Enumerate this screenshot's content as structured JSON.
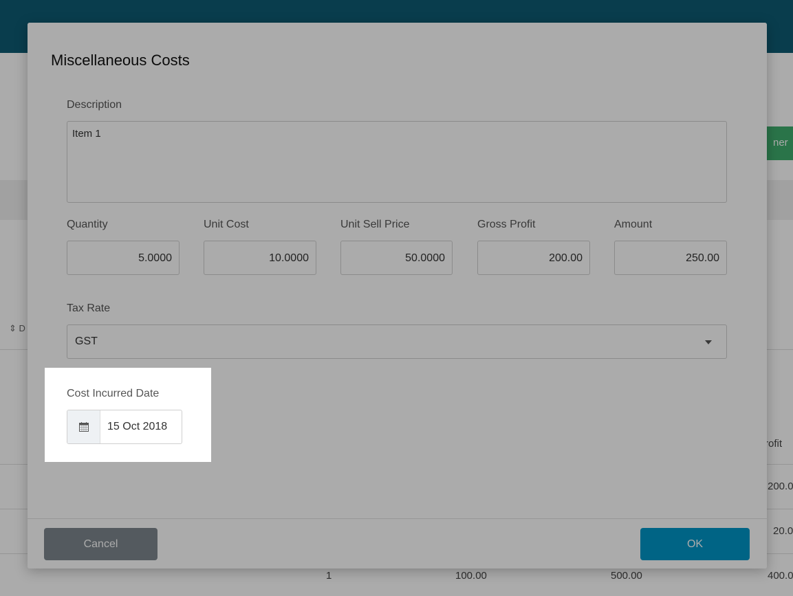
{
  "background": {
    "green_button_label": "ner",
    "sort_label": "D",
    "profit_header": "rofit",
    "rows": [
      {
        "profit": "200.0"
      },
      {
        "profit": "20.0"
      }
    ],
    "bottom_row": {
      "qty": "1",
      "unit_cost": "100.00",
      "amount": "500.00",
      "profit": "400.0"
    }
  },
  "dialog": {
    "title": "Miscellaneous Costs",
    "description_label": "Description",
    "description_value": "Item 1",
    "quantity_label": "Quantity",
    "quantity_value": "5.0000",
    "unit_cost_label": "Unit Cost",
    "unit_cost_value": "10.0000",
    "unit_sell_label": "Unit Sell Price",
    "unit_sell_value": "50.0000",
    "gross_profit_label": "Gross Profit",
    "gross_profit_value": "200.00",
    "amount_label": "Amount",
    "amount_value": "250.00",
    "tax_rate_label": "Tax Rate",
    "tax_rate_value": "GST",
    "cost_date_label": "Cost Incurred Date",
    "cost_date_value": "15 Oct 2018",
    "cancel_label": "Cancel",
    "ok_label": "OK"
  },
  "colors": {
    "topbar": "#0e5c74",
    "ok_button": "#0096c7",
    "cancel_button": "#7e878e",
    "green_button": "#3fae6e"
  }
}
